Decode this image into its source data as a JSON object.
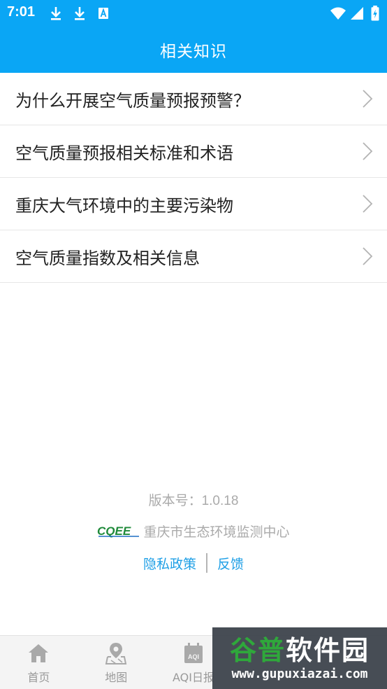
{
  "status_bar": {
    "time": "7:01",
    "icons": [
      "download-icon",
      "download-icon",
      "font-a-icon",
      "wifi-icon",
      "signal-icon",
      "battery-charging-icon"
    ],
    "background_color": "#0aa6f5"
  },
  "header": {
    "title": "相关知识"
  },
  "knowledge_list": {
    "items": [
      {
        "label": "为什么开展空气质量预报预警？",
        "icon": "chevron-right-icon"
      },
      {
        "label": "空气质量预报相关标准和术语",
        "icon": "chevron-right-icon"
      },
      {
        "label": "重庆大气环境中的主要污染物",
        "icon": "chevron-right-icon"
      },
      {
        "label": "空气质量指数及相关信息",
        "icon": "chevron-right-icon"
      }
    ]
  },
  "footer": {
    "version": "版本号：1.0.18",
    "org_name": "重庆市生态环境监测中心",
    "logo_text": "CQEE",
    "privacy_link": "隐私政策",
    "feedback_link": "反馈",
    "link_color": "#1e9fe6"
  },
  "tab_bar": {
    "tabs": [
      {
        "label": "首页",
        "icon": "home-icon"
      },
      {
        "label": "地图",
        "icon": "map-pin-icon"
      },
      {
        "label": "AQI日报",
        "icon": "calendar-aqi-icon"
      }
    ]
  },
  "watermark": {
    "title_part1": "谷普",
    "title_part2": "软件园",
    "url": "www.gupuxiazai.com"
  }
}
